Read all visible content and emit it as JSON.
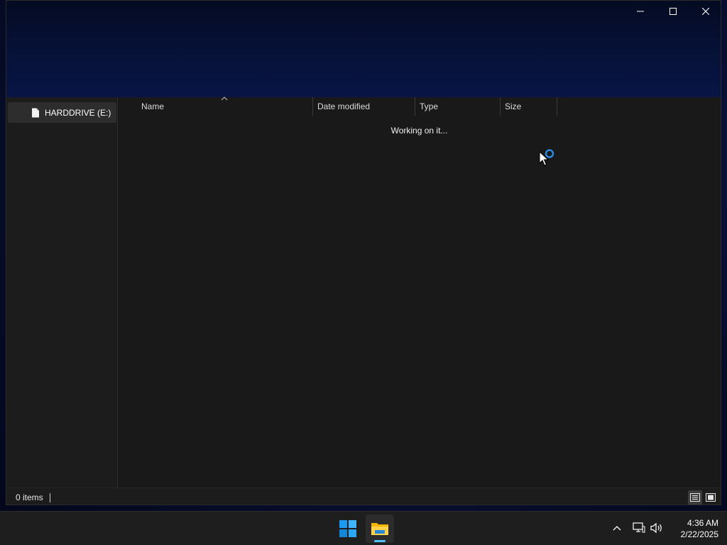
{
  "window": {
    "navigation": {
      "items": [
        {
          "label": "HARDDRIVE (E:)",
          "icon": "document-icon",
          "selected": true
        }
      ]
    },
    "columns": [
      {
        "key": "name",
        "label": "Name",
        "sorted": "ascending"
      },
      {
        "key": "date",
        "label": "Date modified"
      },
      {
        "key": "type",
        "label": "Type"
      },
      {
        "key": "size",
        "label": "Size"
      }
    ],
    "status_message": "Working on it...",
    "statusbar": {
      "item_count": "0 items"
    }
  },
  "taskbar": {
    "apps": [
      {
        "name": "Start",
        "icon": "windows-logo-icon"
      },
      {
        "name": "File Explorer",
        "icon": "folder-icon",
        "active": true
      }
    ],
    "tray": {
      "icons": [
        "chevron-up-icon",
        "network-icon",
        "volume-icon"
      ]
    },
    "clock": {
      "time": "4:36 AM",
      "date": "2/22/2025"
    }
  },
  "colors": {
    "accent": "#4cc2ff",
    "window_bg": "#191919",
    "selected_nav": "#2d2d2d",
    "cursor_ring": "#2a8be0"
  }
}
